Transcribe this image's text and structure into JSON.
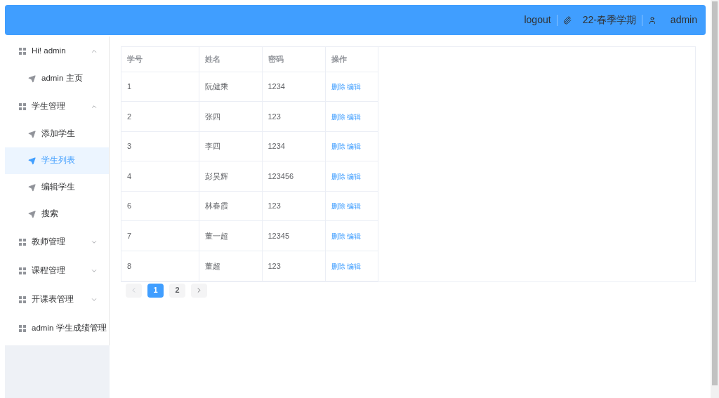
{
  "header": {
    "logout": "logout",
    "term": "22-春季学期",
    "user": "admin"
  },
  "sidebar": {
    "groups": [
      {
        "label": "Hi! admin",
        "expanded": true,
        "children": [
          {
            "label": "admin 主页",
            "selected": false
          }
        ]
      },
      {
        "label": "学生管理",
        "expanded": true,
        "children": [
          {
            "label": "添加学生",
            "selected": false
          },
          {
            "label": "学生列表",
            "selected": true
          },
          {
            "label": "编辑学生",
            "selected": false
          },
          {
            "label": "搜索",
            "selected": false
          }
        ]
      },
      {
        "label": "教师管理",
        "expanded": false
      },
      {
        "label": "课程管理",
        "expanded": false
      },
      {
        "label": "开课表管理",
        "expanded": false
      },
      {
        "label": "admin 学生成绩管理"
      }
    ]
  },
  "table": {
    "columns": [
      "学号",
      "姓名",
      "密码",
      "操作"
    ],
    "rows": [
      {
        "id": "1",
        "name": "阮健乘",
        "password": "1234",
        "actions": [
          "删除",
          "编辑"
        ]
      },
      {
        "id": "2",
        "name": "张四",
        "password": "123",
        "actions": [
          "删除",
          "编辑"
        ]
      },
      {
        "id": "3",
        "name": "李四",
        "password": "1234",
        "actions": [
          "删除",
          "编辑"
        ]
      },
      {
        "id": "4",
        "name": "彭昊辉",
        "password": "123456",
        "actions": [
          "删除",
          "编辑"
        ]
      },
      {
        "id": "6",
        "name": "林春霞",
        "password": "123",
        "actions": [
          "删除",
          "编辑"
        ]
      },
      {
        "id": "7",
        "name": "董一超",
        "password": "12345",
        "actions": [
          "删除",
          "编辑"
        ]
      },
      {
        "id": "8",
        "name": "董超",
        "password": "123",
        "actions": [
          "删除",
          "编辑"
        ]
      }
    ]
  },
  "pagination": {
    "prev_disabled": true,
    "pages": [
      {
        "label": "1",
        "selected": true
      },
      {
        "label": "2",
        "selected": false
      }
    ]
  }
}
